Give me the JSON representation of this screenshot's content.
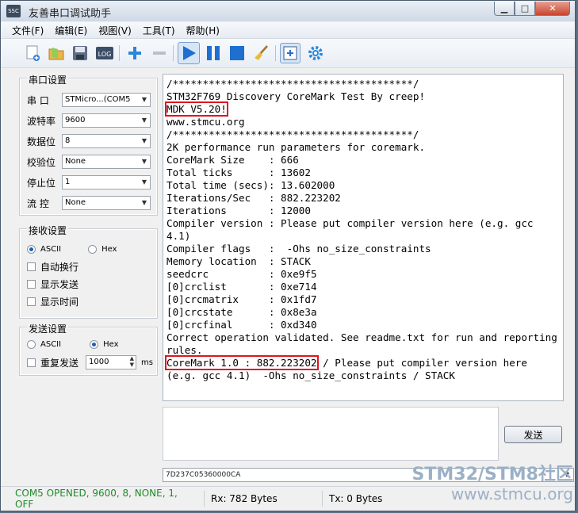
{
  "window": {
    "title": "友善串口调试助手",
    "app_icon": "SSC"
  },
  "menu": [
    "文件(F)",
    "编辑(E)",
    "视图(V)",
    "工具(T)",
    "帮助(H)"
  ],
  "toolbar_icons": [
    "new-doc-icon",
    "open-folder-icon",
    "save-icon",
    "log-icon",
    "add-icon",
    "remove-icon",
    "play-icon",
    "pause-icon",
    "stop-icon",
    "clear-broom-icon",
    "add-window-icon",
    "settings-gear-icon"
  ],
  "serial_settings": {
    "title": "串口设置",
    "port_label": "串  口",
    "port_value": "STMicro...(COM5",
    "baud_label": "波特率",
    "baud_value": "9600",
    "databits_label": "数据位",
    "databits_value": "8",
    "parity_label": "校验位",
    "parity_value": "None",
    "stopbits_label": "停止位",
    "stopbits_value": "1",
    "flow_label": "流  控",
    "flow_value": "None"
  },
  "receive_settings": {
    "title": "接收设置",
    "ascii_label": "ASCII",
    "hex_label": "Hex",
    "auto_wrap_label": "自动换行",
    "show_send_label": "显示发送",
    "show_time_label": "显示时间"
  },
  "send_settings": {
    "title": "发送设置",
    "ascii_label": "ASCII",
    "hex_label": "Hex",
    "repeat_label": "重复发送",
    "interval_value": "1000",
    "interval_unit": "ms"
  },
  "output": {
    "line_01": "/****************************************/",
    "line_02": "STM32F769 Discovery CoreMark Test By creep!",
    "line_03": "MDK V5.20!",
    "line_04": "www.stmcu.org",
    "line_05": "/****************************************/",
    "line_06": "2K performance run parameters for coremark.",
    "line_07": "CoreMark Size    : 666",
    "line_08": "Total ticks      : 13602",
    "line_09": "Total time (secs): 13.602000",
    "line_10": "Iterations/Sec   : 882.223202",
    "line_11": "Iterations       : 12000",
    "line_12": "Compiler version : Please put compiler version here (e.g. gcc 4.1)",
    "line_13": "Compiler flags   :  -Ohs no_size_constraints",
    "line_14": "Memory location  : STACK",
    "line_15": "seedcrc          : 0xe9f5",
    "line_16": "[0]crclist       : 0xe714",
    "line_17": "[0]crcmatrix     : 0x1fd7",
    "line_18": "[0]crcstate      : 0x8e3a",
    "line_19": "[0]crcfinal      : 0xd340",
    "line_20": "Correct operation validated. See readme.txt for run and reporting rules.",
    "line_21_highlight": "CoreMark 1.0 : 882.223202",
    "line_21_rest": " / Please put compiler version here (e.g. gcc 4.1)  -Ohs no_size_constraints / STACK"
  },
  "send_button": "发送",
  "history_value": "7D237C05360000CA",
  "status": {
    "port": "COM5 OPENED, 9600, 8, NONE, 1, OFF",
    "rx": "Rx: 782 Bytes",
    "tx": "Tx: 0 Bytes"
  },
  "watermark": {
    "line1": "STM32/STM8社区",
    "line2": "www.stmcu.org"
  },
  "colors": {
    "highlight": "#e0141e",
    "status_green": "#1f8a2a",
    "accent_blue": "#1e6fd0"
  }
}
